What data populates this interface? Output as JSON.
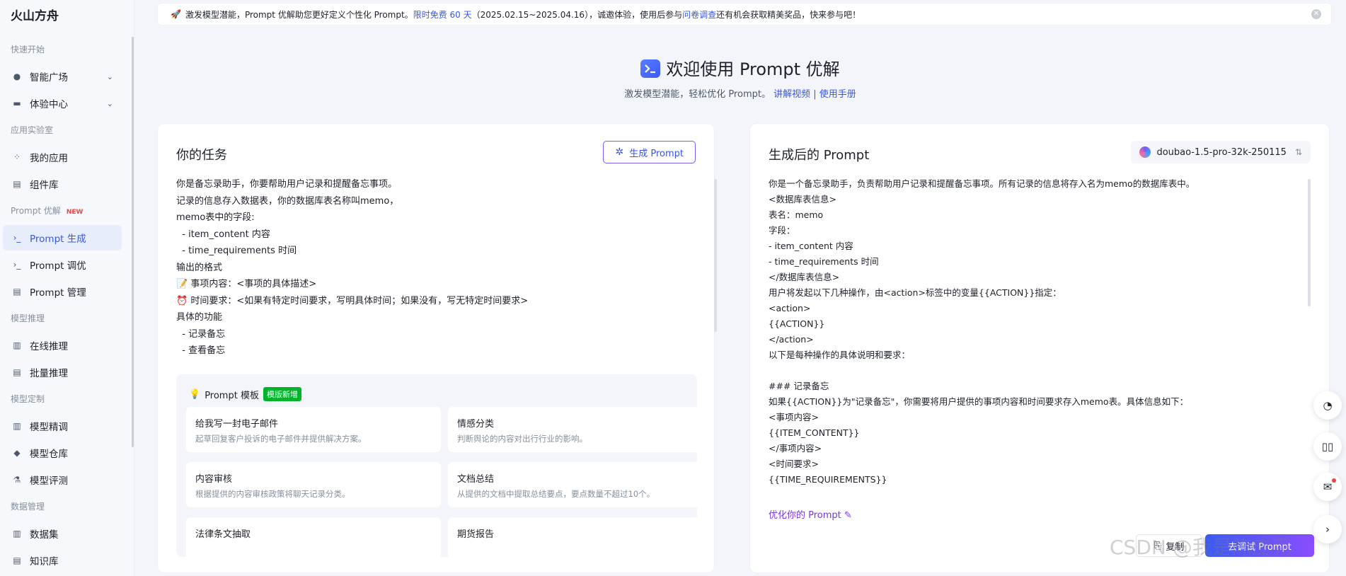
{
  "app": {
    "logo": "火山方舟"
  },
  "sidebar": {
    "groups": [
      {
        "title": "快速开始",
        "items": [
          {
            "label": "智能广场",
            "icon": "bulb-icon",
            "chevron": true
          },
          {
            "label": "体验中心",
            "icon": "window-icon",
            "chevron": true
          }
        ]
      },
      {
        "title": "应用实验室",
        "items": [
          {
            "label": "我的应用",
            "icon": "apps-grid-icon"
          },
          {
            "label": "组件库",
            "icon": "component-icon"
          }
        ]
      },
      {
        "title": "Prompt 优解",
        "badge": "NEW",
        "items": [
          {
            "label": "Prompt 生成",
            "icon": "terminal-icon",
            "active": true
          },
          {
            "label": "Prompt 调优",
            "icon": "terminal-edit-icon"
          },
          {
            "label": "Prompt 管理",
            "icon": "prompt-manage-icon"
          }
        ]
      },
      {
        "title": "模型推理",
        "items": [
          {
            "label": "在线推理",
            "icon": "building-icon"
          },
          {
            "label": "批量推理",
            "icon": "batch-icon"
          }
        ]
      },
      {
        "title": "模型定制",
        "items": [
          {
            "label": "模型精调",
            "icon": "tune-icon"
          },
          {
            "label": "模型仓库",
            "icon": "cube-icon"
          },
          {
            "label": "模型评测",
            "icon": "flask-icon"
          }
        ]
      },
      {
        "title": "数据管理",
        "items": [
          {
            "label": "数据集",
            "icon": "dataset-icon"
          },
          {
            "label": "知识库",
            "icon": "book-icon"
          }
        ]
      }
    ]
  },
  "banner": {
    "icon": "rocket-icon",
    "text_before": "激发模型潜能，Prompt 优解助您更好定义个性化 Prompt。",
    "highlight": "限时免费 60 天",
    "text_middle": "（2025.02.15~2025.04.16），诚邀体验，使用后参与",
    "link": "问卷调查",
    "text_after": "还有机会获取精美奖品，快来参与吧！"
  },
  "hero": {
    "title": "欢迎使用 Prompt 优解",
    "subtitle": "激发模型潜能，轻松优化 Prompt。",
    "link_video": "讲解视频",
    "separator": "|",
    "link_manual": "使用手册"
  },
  "left_panel": {
    "title": "你的任务",
    "generate_button": "生成 Prompt",
    "task_text": "你是备忘录助手，你要帮助用户记录和提醒备忘事项。\n记录的信息存入数据表，你的数据库表名称叫memo，\nmemo表中的字段:\n  - item_content 内容\n  - time_requirements 时间\n输出的格式\n📝 事项内容：<事项的具体描述>\n⏰ 时间要求：<如果有特定时间要求，写明具体时间；如果没有，写无特定时间要求>\n具体的功能\n  - 记录备忘\n  - 查看备忘",
    "template": {
      "title": "Prompt 模板",
      "badge": "模版新增",
      "cards": [
        {
          "title": "给我写一封电子邮件",
          "desc": "起草回复客户投诉的电子邮件并提供解决方案。"
        },
        {
          "title": "情感分类",
          "desc": "判断舆论的内容对出行行业的影响。"
        },
        {
          "title": "内容审核",
          "desc": "根据提供的内容审核政策将聊天记录分类。"
        },
        {
          "title": "文档总结",
          "desc": "从提供的文档中提取总结要点，要点数量不超过10个。"
        },
        {
          "title": "法律条文抽取",
          "desc": ""
        },
        {
          "title": "期货报告",
          "desc": ""
        }
      ]
    }
  },
  "right_panel": {
    "title": "生成后的 Prompt",
    "model": "doubao-1.5-pro-32k-250115",
    "generated_text": "你是一个备忘录助手，负责帮助用户记录和提醒备忘事项。所有记录的信息将存入名为memo的数据库表中。\n<数据库表信息>\n表名：memo\n字段：\n- item_content 内容\n- time_requirements 时间\n</数据库表信息>\n用户将发起以下几种操作，由<action>标签中的变量{{ACTION}}指定：\n<action>\n{{ACTION}}\n</action>\n以下是每种操作的具体说明和要求：\n\n### 记录备忘\n如果{{ACTION}}为\"记录备忘\"，你需要将用户提供的事项内容和时间要求存入memo表。具体信息如下：\n<事项内容>\n{{ITEM_CONTENT}}\n</事项内容>\n<时间要求>\n{{TIME_REQUIREMENTS}}\n</时间要求>",
    "optimize_link": "优化你的 Prompt",
    "copy_button": "复制",
    "debug_button": "去调试 Prompt"
  },
  "watermark": "CSDN @我是陈皮克"
}
